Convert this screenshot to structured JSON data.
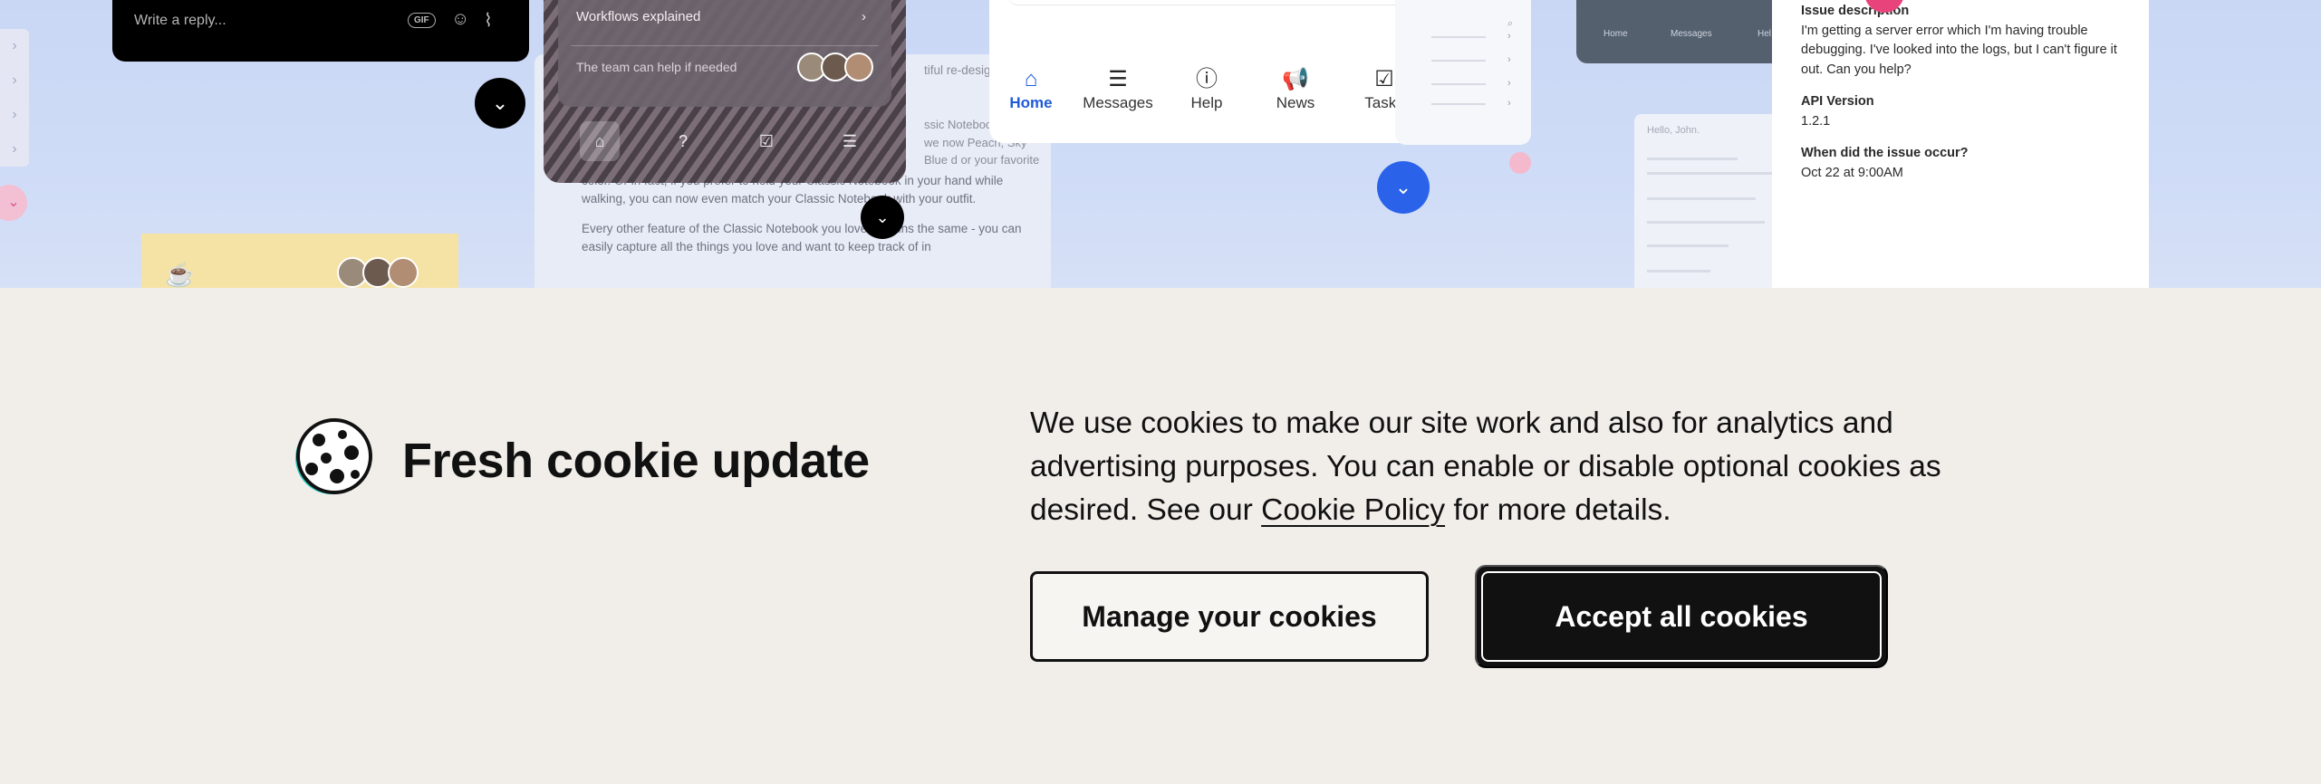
{
  "background": {
    "reply_card": {
      "placeholder": "Write a reply...",
      "gif_label": "GIF"
    },
    "workflow_card": {
      "link_label": "Workflows explained",
      "help_text": "The team can help if needed"
    },
    "article": {
      "fragment_top": "tiful re-design",
      "fragment_side": "ssic Notebook. tebook, we now Peach, Sky Blue d or your favorite",
      "paragraph1": "color. Or in fact, if you prefer to hold your Classic Notebook in your hand while walking, you can now even match your Classic Notebook with your outfit.",
      "paragraph2": "Every other feature of the Classic Notebook you love remains the same - you can easily capture all the things you love and want to keep track of in"
    },
    "messenger_nav": {
      "items": [
        {
          "label": "Home",
          "icon": "home-icon"
        },
        {
          "label": "Messages",
          "icon": "messages-icon"
        },
        {
          "label": "Help",
          "icon": "help-icon"
        },
        {
          "label": "News",
          "icon": "news-icon"
        },
        {
          "label": "Tasks",
          "icon": "tasks-icon"
        }
      ],
      "active": "Home"
    },
    "dark_tabs": {
      "home": "Home",
      "messages": "Messages",
      "help": "Hel"
    },
    "chat_card": {
      "greeting": "Hello, John."
    },
    "issue_panel": {
      "description_label": "Issue description",
      "description_value": "I'm getting a server error which I'm having trouble debugging. I've looked into the logs, but I can't figure it out. Can you help?",
      "api_label": "API Version",
      "api_value": "1.2.1",
      "when_label": "When did the issue occur?",
      "when_value": "Oct 22 at 9:00AM"
    },
    "colors": {
      "accent_blue": "#1f5bd9",
      "pink": "#e8447b",
      "sky": "#cfdcf7"
    }
  },
  "banner": {
    "title": "Fresh cookie update",
    "text_before": "We use cookies to make our site work and also for analytics and advertising purposes. You can enable or disable optional cookies as desired. See our ",
    "policy_link": "Cookie Policy",
    "text_after": " for more details.",
    "manage_button": "Manage your cookies",
    "accept_button": "Accept all cookies",
    "colors": {
      "background": "#f1eeea",
      "button_dark": "#111111"
    }
  }
}
